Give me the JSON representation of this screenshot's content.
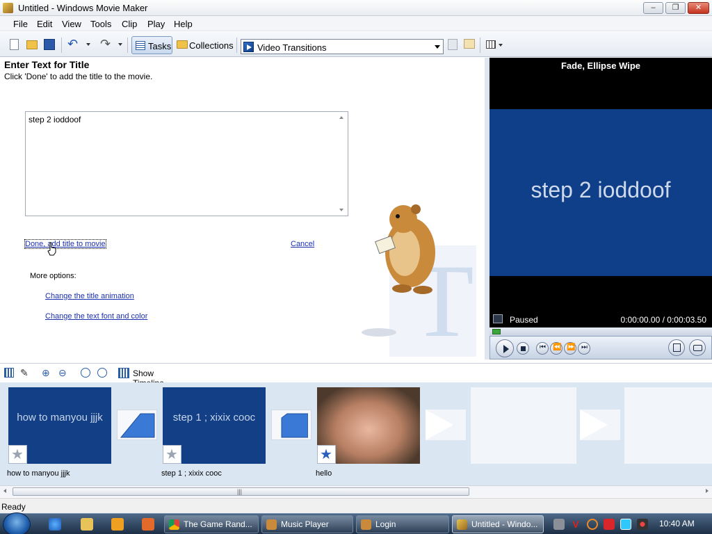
{
  "window": {
    "title": "Untitled - Windows Movie Maker"
  },
  "menu": [
    "File",
    "Edit",
    "View",
    "Tools",
    "Clip",
    "Play",
    "Help"
  ],
  "toolbar": {
    "tasks_label": "Tasks",
    "collections_label": "Collections",
    "collection_selected": "Video Transitions"
  },
  "title_pane": {
    "heading": "Enter Text for Title",
    "subheading": "Click 'Done' to add the title to the movie.",
    "title_text": "step 2 ioddoof",
    "done_link": "Done, add title to movie",
    "cancel_link": "Cancel",
    "more_options": "More options:",
    "change_animation_link": "Change the title animation",
    "change_font_link": "Change the text font and color"
  },
  "monitor": {
    "title": "Fade, Ellipse Wipe",
    "preview_text": "step 2 ioddoof",
    "status": "Paused",
    "time": "0:00:00.00 / 0:00:03.50",
    "seek_progress": 0
  },
  "timeline_toolbar": {
    "show_timeline_label": "Show Timeline"
  },
  "storyboard": {
    "clips": [
      {
        "text": "how to manyou jjjk",
        "caption": "how to manyou jjjk"
      },
      {
        "text": "step 1 ; xixix cooc",
        "caption": "step 1 ; xixix cooc"
      },
      {
        "text": "",
        "caption": "hello"
      }
    ]
  },
  "status_bar": {
    "text": "Ready"
  },
  "taskbar": {
    "tasks": [
      {
        "label": "The Game Rand..."
      },
      {
        "label": "Music Player"
      },
      {
        "label": "Login"
      },
      {
        "label": "Untitled - Windo..."
      }
    ],
    "clock": "10:40 AM"
  },
  "colors": {
    "accent": "#0f3f88",
    "link": "#1a2fb0",
    "taskbar": "#1d2f46"
  }
}
